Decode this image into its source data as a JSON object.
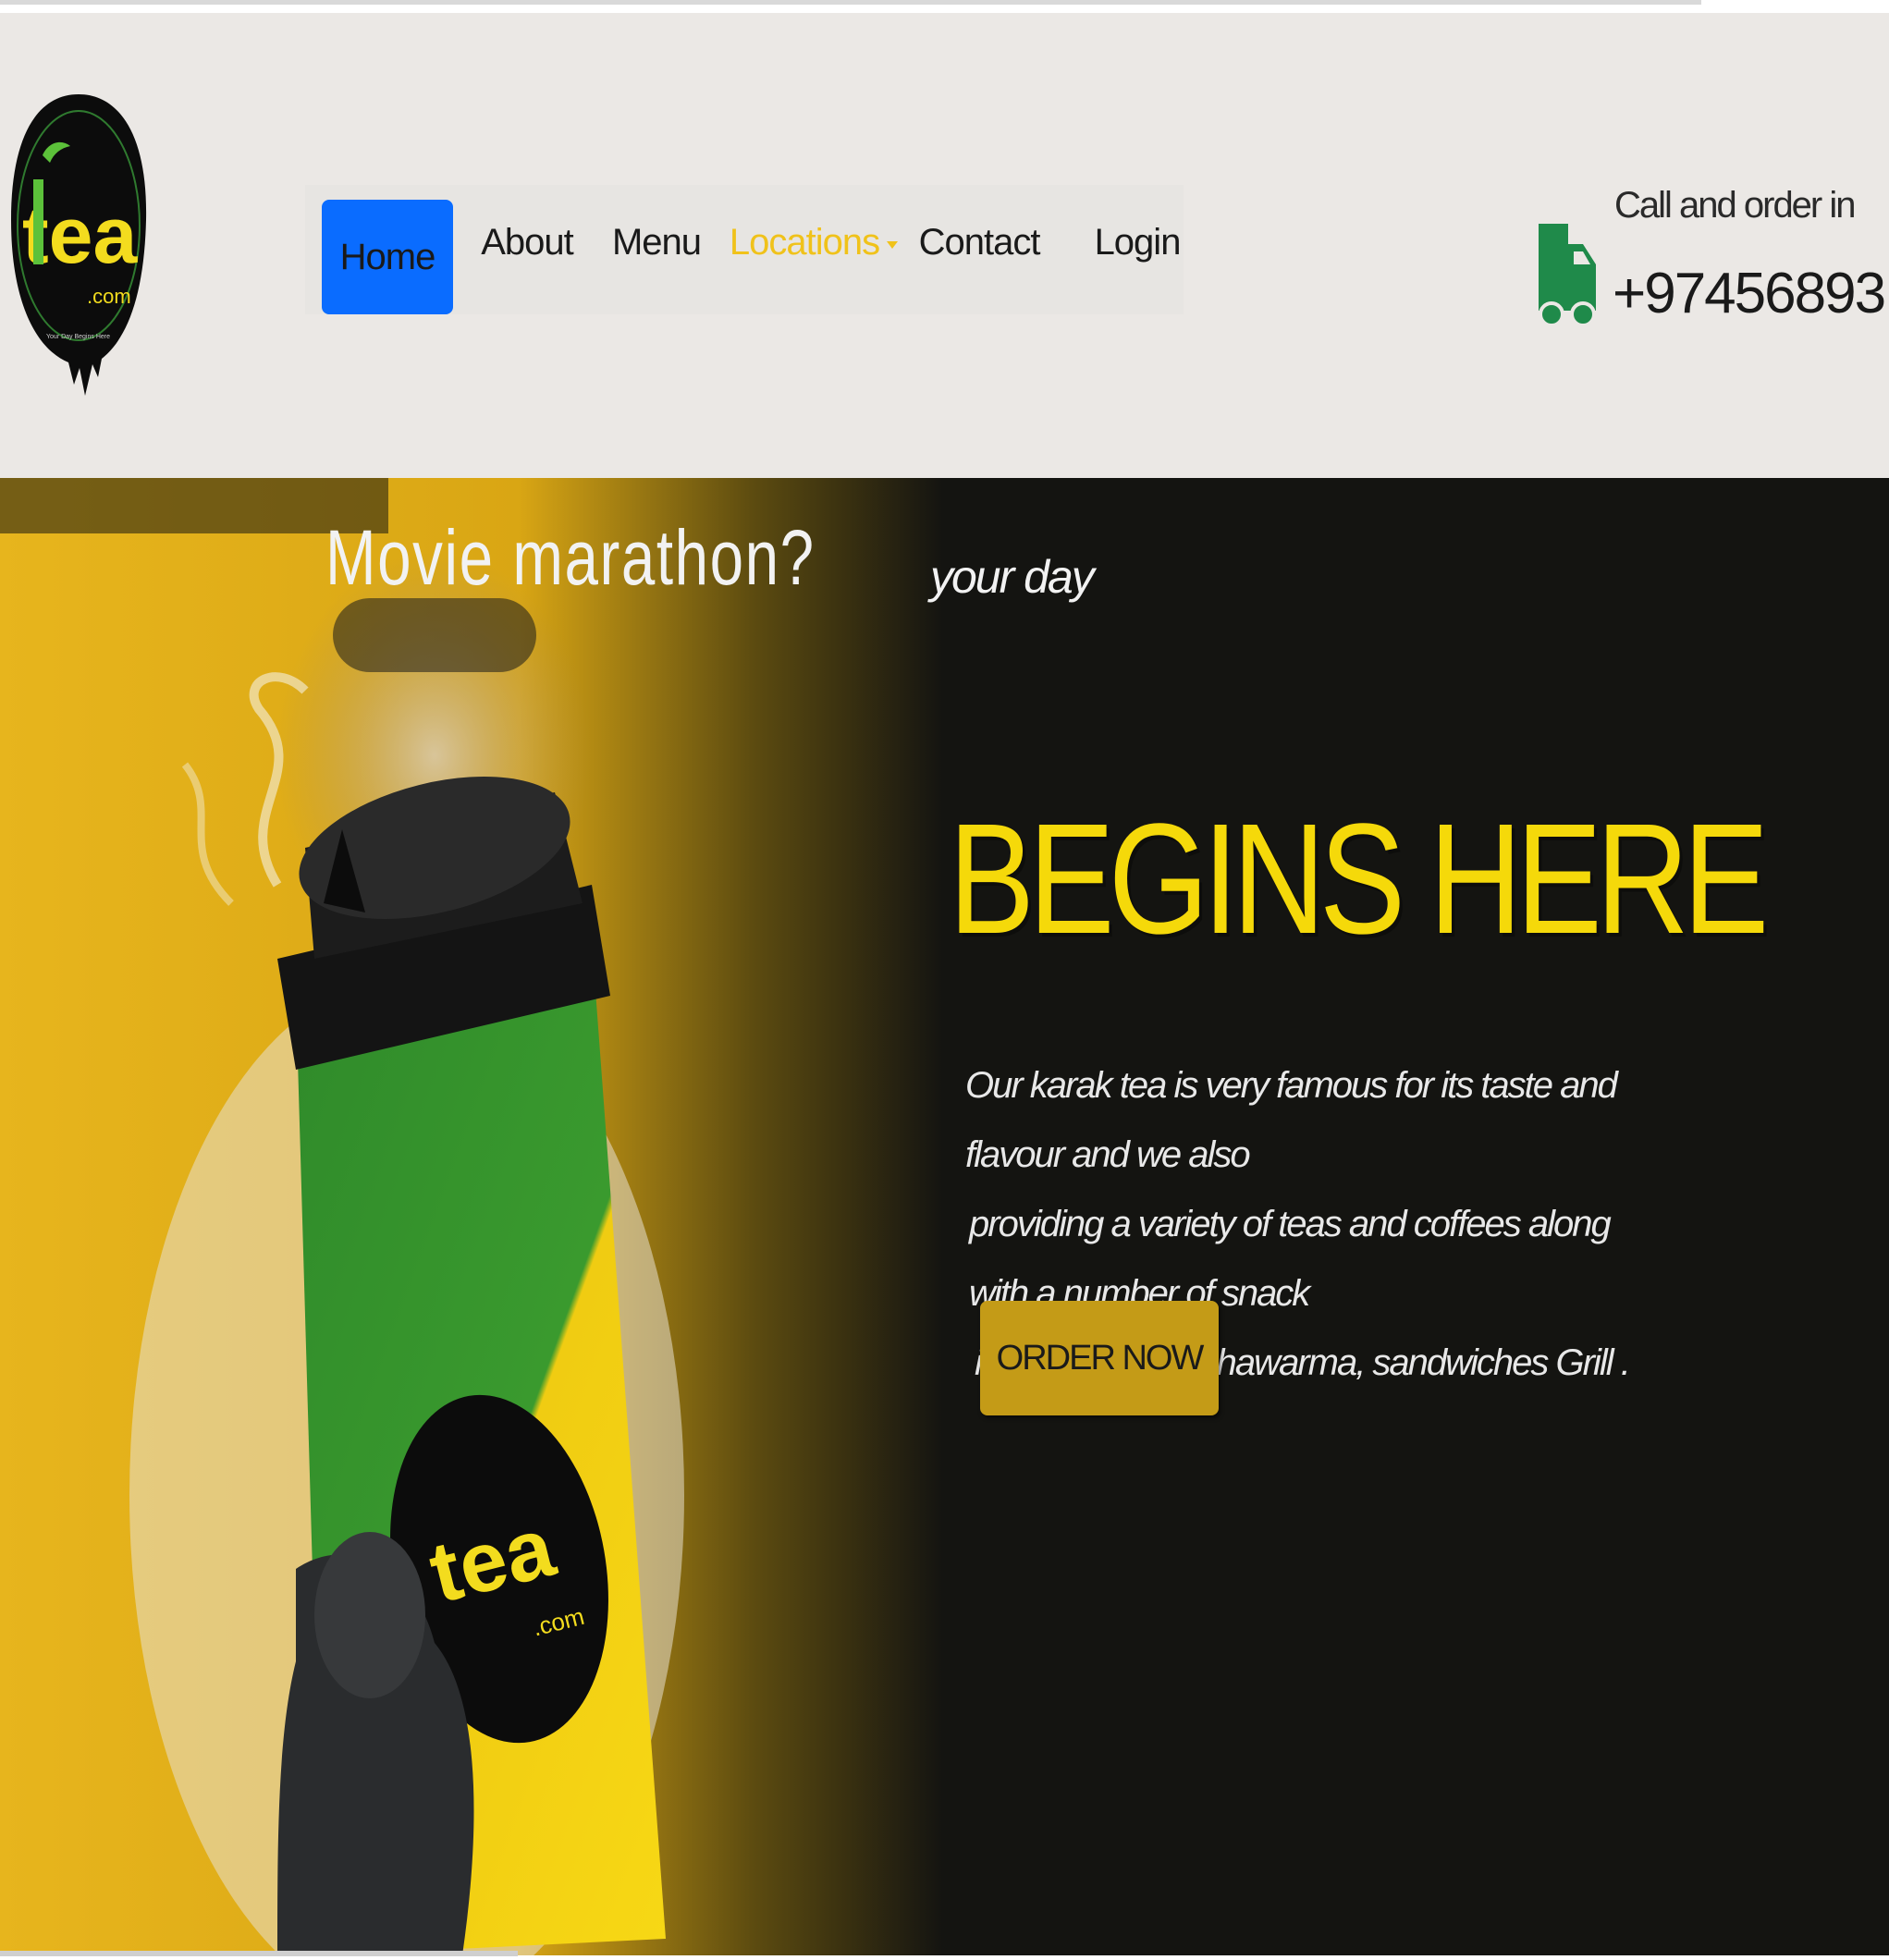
{
  "brand": {
    "logo_text": "tea",
    "logo_suffix": ".com",
    "logo_tagline": "Your Day Begins Here"
  },
  "nav": {
    "items": [
      {
        "label": "Home"
      },
      {
        "label": "About"
      },
      {
        "label": "Menu"
      },
      {
        "label": "Locations"
      },
      {
        "label": "Contact"
      },
      {
        "label": "Login"
      }
    ],
    "active": "Home"
  },
  "call": {
    "label": "Call and order in",
    "phone": "+97456893",
    "icon": "truck-icon"
  },
  "hero": {
    "title": "Movie marathon?",
    "kicker": "your day",
    "headline": "BEGINS HERE",
    "body_lines": [
      "Our karak tea is very famous for its taste and flavour and we also",
      "providing a variety of teas and coffees along with a number of snack",
      "items including shawarma, sandwiches Grill ."
    ],
    "cta": "ORDER NOW",
    "cup_logo_text": "tea",
    "cup_logo_suffix": ".com"
  },
  "colors": {
    "header_bg": "#ebe8e5",
    "active_nav": "#0a6cff",
    "locations_link": "#f0c21a",
    "headline": "#f5d90a",
    "cta_bg": "#c49b17",
    "truck": "#1f8a4a",
    "hero_bg": "#141411"
  }
}
